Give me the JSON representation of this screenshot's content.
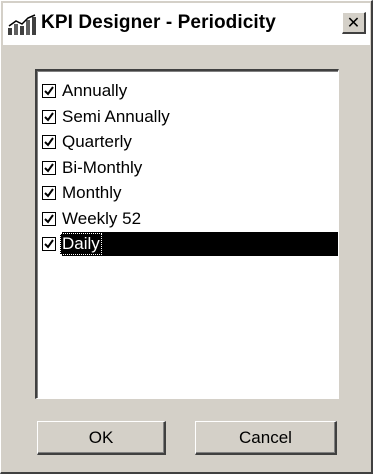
{
  "window": {
    "title": "KPI Designer - Periodicity",
    "app_icon": "chart-icon",
    "close_glyph": "✕"
  },
  "list": {
    "items": [
      {
        "label": "Annually",
        "checked": true,
        "selected": false
      },
      {
        "label": "Semi Annually",
        "checked": true,
        "selected": false
      },
      {
        "label": "Quarterly",
        "checked": true,
        "selected": false
      },
      {
        "label": "Bi-Monthly",
        "checked": true,
        "selected": false
      },
      {
        "label": "Monthly",
        "checked": true,
        "selected": false
      },
      {
        "label": "Weekly 52",
        "checked": true,
        "selected": false
      },
      {
        "label": "Daily",
        "checked": true,
        "selected": true
      }
    ]
  },
  "buttons": {
    "ok_label": "OK",
    "cancel_label": "Cancel"
  },
  "colors": {
    "face": "#d4d0c8",
    "selection": "#000000",
    "list_background": "#ffffff"
  }
}
